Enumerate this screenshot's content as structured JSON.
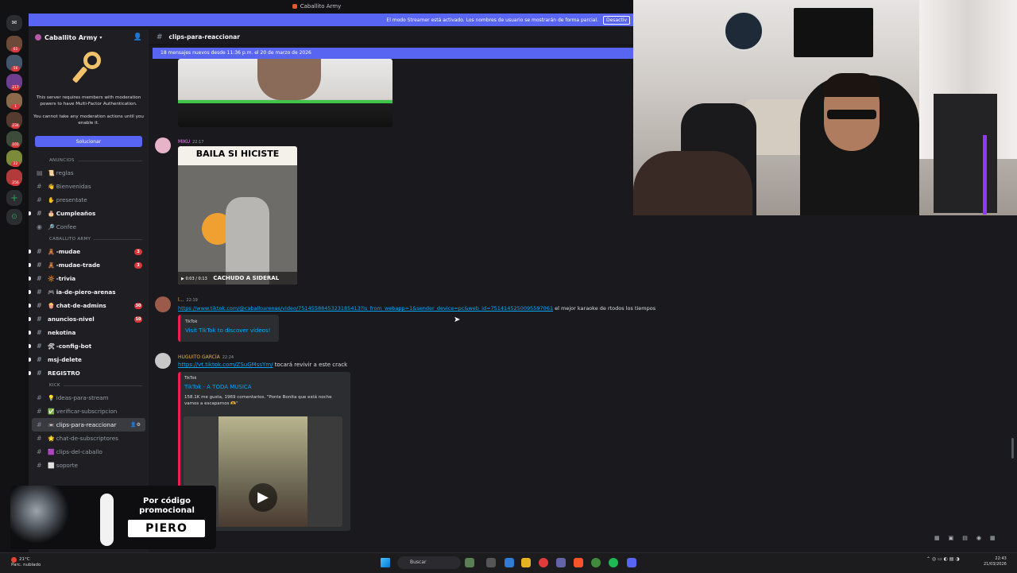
{
  "window": {
    "title": "Caballito Army"
  },
  "streamer_banner": {
    "text": "El modo Streamer está activado. Los nombres de usuario se mostrarán de forma parcial.",
    "action": "Desactiv"
  },
  "server": {
    "name": "Caballito Army"
  },
  "mfa": {
    "line1": "This server requires members with moderation powers to have Multi-Factor Authentication.",
    "line2": "You cannot take any moderation actions until you enable it.",
    "button": "Solucionar"
  },
  "rail": {
    "badges": [
      "61",
      "56",
      "217",
      "1",
      "234",
      "101",
      "22",
      "256"
    ]
  },
  "sidebar": {
    "cat1": "Anuncios",
    "cat1_channels": [
      {
        "emoji": "📜",
        "name": "reglas"
      },
      {
        "emoji": "👋",
        "name": "Bienvenidas"
      },
      {
        "emoji": "✋",
        "name": "presentate"
      },
      {
        "emoji": "🎂",
        "name": "Cumpleaños"
      },
      {
        "emoji": "🔎",
        "name": "Confee"
      }
    ],
    "cat2": "Caballito Army",
    "cat2_channels": [
      {
        "emoji": "🧸",
        "name": "-mudae",
        "count": "3"
      },
      {
        "emoji": "🧸",
        "name": "-mudae-trade",
        "count": "3"
      },
      {
        "emoji": "🔆",
        "name": "-trivia",
        "count": ""
      },
      {
        "emoji": "🎮",
        "name": "ia-de-piero-arenas",
        "count": ""
      },
      {
        "emoji": "🍿",
        "name": "chat-de-admins",
        "count": "30"
      },
      {
        "emoji": "",
        "name": "anuncios-nivel",
        "count": "10"
      },
      {
        "emoji": "",
        "name": "nekotina",
        "count": ""
      },
      {
        "emoji": "🛠",
        "name": "-config-bot",
        "count": ""
      },
      {
        "emoji": "",
        "name": "msj-delete",
        "count": ""
      },
      {
        "emoji": "",
        "name": "REGISTRO",
        "count": ""
      }
    ],
    "cat3": "Kick",
    "cat3_channels": [
      {
        "emoji": "💡",
        "name": "ideas-para-stream"
      },
      {
        "emoji": "✅",
        "name": "verificar-subscripcion"
      },
      {
        "emoji": "📼",
        "name": "clips-para-reaccionar"
      },
      {
        "emoji": "🌟",
        "name": "chat-de-subscriptores"
      },
      {
        "emoji": "🟪",
        "name": "clips-del-caballo"
      },
      {
        "emoji": "⬜",
        "name": "soporte"
      }
    ]
  },
  "channel": {
    "name": "clips-para-reaccionar"
  },
  "new_messages": "18 mensajes nuevos desde 11:36 p.m. el 20 de marzo de 2026",
  "messages": {
    "m1": {
      "user": "MIKU",
      "time": "22:17",
      "gif_caption": "BAILA SI HICISTE",
      "gif_subtitle": "CACHUDO A SIDERAL",
      "gif_time": "0:03 / 0:13"
    },
    "m2": {
      "user": "l...",
      "time": "22:19",
      "link": "https://www.tiktok.com/@caballoarenas/video/7514558845323185413?is_from_webapp=1&sender_device=pc&web_id=7514145250095597061",
      "text": "el mejor karaoke de rtodos los tiempos",
      "embed_provider": "TikTok",
      "embed_title": "Visit TikTok to discover videos!"
    },
    "m3": {
      "user": "HUGUITO GARCÍA",
      "time": "22:24",
      "link": "https://vt.tiktok.com/ZSuGMssYm/",
      "text": "tocará revivir a este crack",
      "embed_provider": "TikTok",
      "embed_title": "TikTok · A TODA MUSICA",
      "embed_desc": "158.1K me gusta, 1969 comentarios. \"Ponte Bonita que está noche vamos a escaparnos 🫶\""
    }
  },
  "promo": {
    "line1": "Por código promocional",
    "code": "PIERO"
  },
  "taskbar": {
    "weather_temp": "21°C",
    "weather_desc": "Parc. nublado",
    "search": "Buscar",
    "time": "22:43",
    "date": "21/03/2026"
  },
  "colors": {
    "blurple": "#5865f2",
    "link": "#00a8fc",
    "badge": "#da373c",
    "tiktok": "#ee1d52"
  }
}
